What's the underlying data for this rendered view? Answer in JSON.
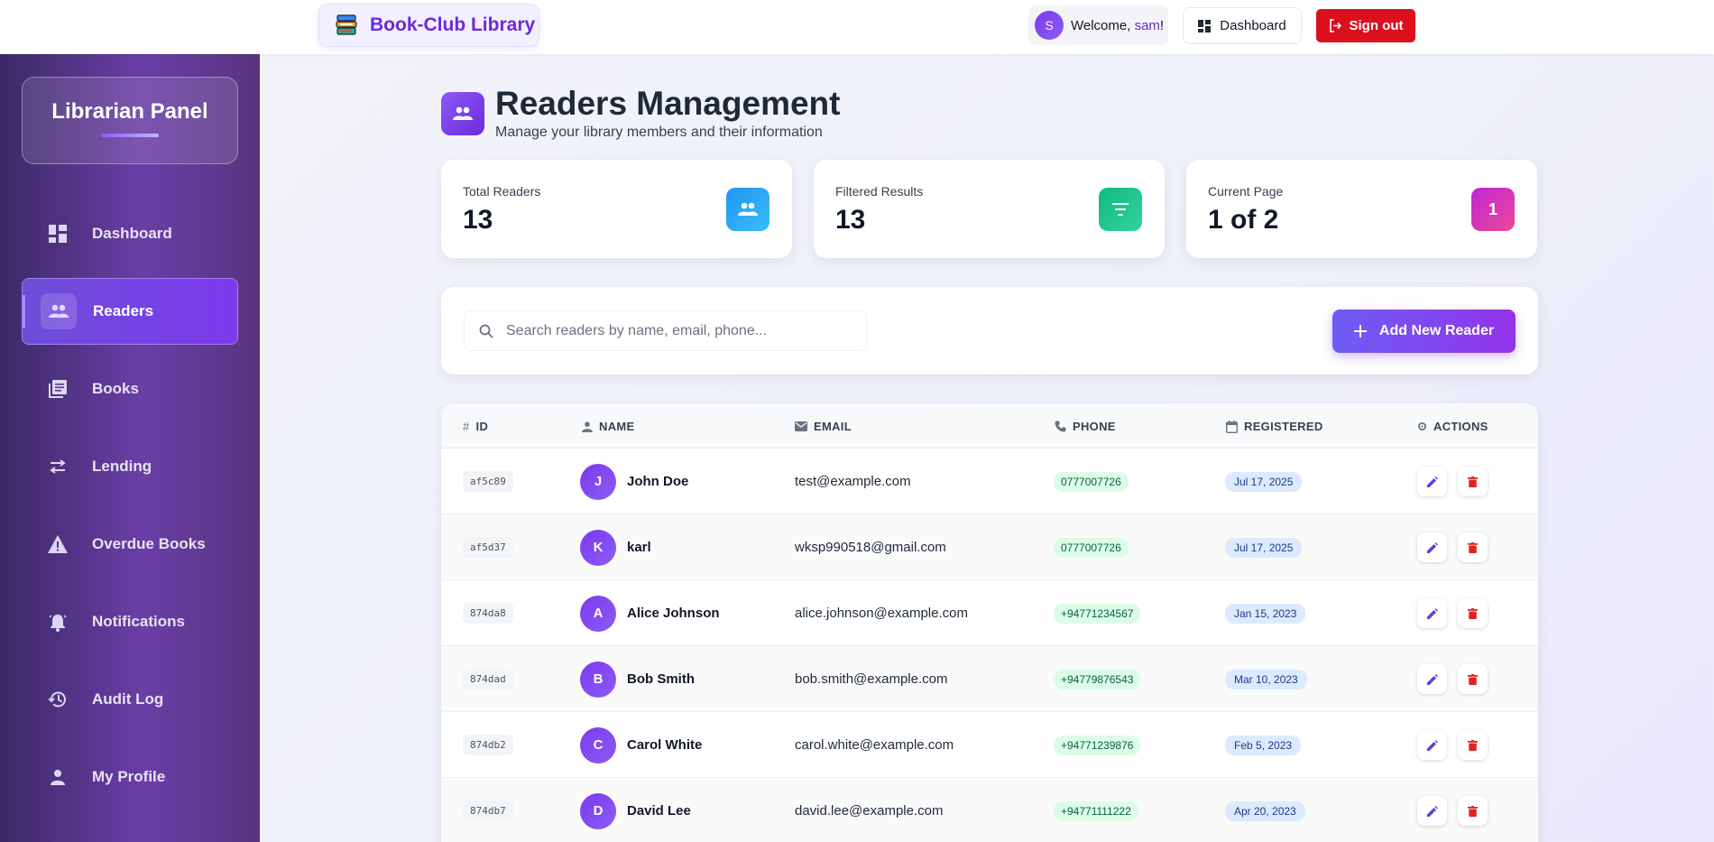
{
  "topbar": {
    "brand": "Book-Club Library",
    "welcome_prefix": "Welcome, ",
    "username": "sam",
    "welcome_suffix": "!",
    "user_initial": "S",
    "dashboard_label": "Dashboard",
    "signout_label": "Sign out"
  },
  "sidebar": {
    "panel_title": "Librarian Panel",
    "items": [
      {
        "label": "Dashboard",
        "icon": "dashboard-icon"
      },
      {
        "label": "Readers",
        "icon": "people-icon",
        "active": true
      },
      {
        "label": "Books",
        "icon": "library-books-icon"
      },
      {
        "label": "Lending",
        "icon": "swap-icon"
      },
      {
        "label": "Overdue Books",
        "icon": "warning-icon"
      },
      {
        "label": "Notifications",
        "icon": "bell-icon"
      },
      {
        "label": "Audit Log",
        "icon": "history-icon"
      },
      {
        "label": "My Profile",
        "icon": "person-icon"
      }
    ]
  },
  "page": {
    "title": "Readers Management",
    "subtitle": "Manage your library members and their information"
  },
  "stats": [
    {
      "label": "Total Readers",
      "value": "13",
      "icon": "people-icon",
      "color": "#2196f3"
    },
    {
      "label": "Filtered Results",
      "value": "13",
      "icon": "filter-icon",
      "color": "#10b981"
    },
    {
      "label": "Current Page",
      "value": "1 of 2",
      "icon_text": "1",
      "color": "#ec4899"
    }
  ],
  "search": {
    "placeholder": "Search readers by name, email, phone...",
    "value": ""
  },
  "add_button": "Add New Reader",
  "table": {
    "headers": {
      "id": "ID",
      "name": "NAME",
      "email": "EMAIL",
      "phone": "PHONE",
      "registered": "REGISTERED",
      "actions": "ACTIONS"
    },
    "rows": [
      {
        "id": "af5c89",
        "initial": "J",
        "name": "John Doe",
        "email": "test@example.com",
        "phone": "0777007726",
        "registered": "Jul 17, 2025"
      },
      {
        "id": "af5d37",
        "initial": "K",
        "name": "karl",
        "email": "wksp990518@gmail.com",
        "phone": "0777007726",
        "registered": "Jul 17, 2025"
      },
      {
        "id": "874da8",
        "initial": "A",
        "name": "Alice Johnson",
        "email": "alice.johnson@example.com",
        "phone": "+94771234567",
        "registered": "Jan 15, 2023"
      },
      {
        "id": "874dad",
        "initial": "B",
        "name": "Bob Smith",
        "email": "bob.smith@example.com",
        "phone": "+94779876543",
        "registered": "Mar 10, 2023"
      },
      {
        "id": "874db2",
        "initial": "C",
        "name": "Carol White",
        "email": "carol.white@example.com",
        "phone": "+94771239876",
        "registered": "Feb 5, 2023"
      },
      {
        "id": "874db7",
        "initial": "D",
        "name": "David Lee",
        "email": "david.lee@example.com",
        "phone": "+94771111222",
        "registered": "Apr 20, 2023"
      }
    ]
  }
}
